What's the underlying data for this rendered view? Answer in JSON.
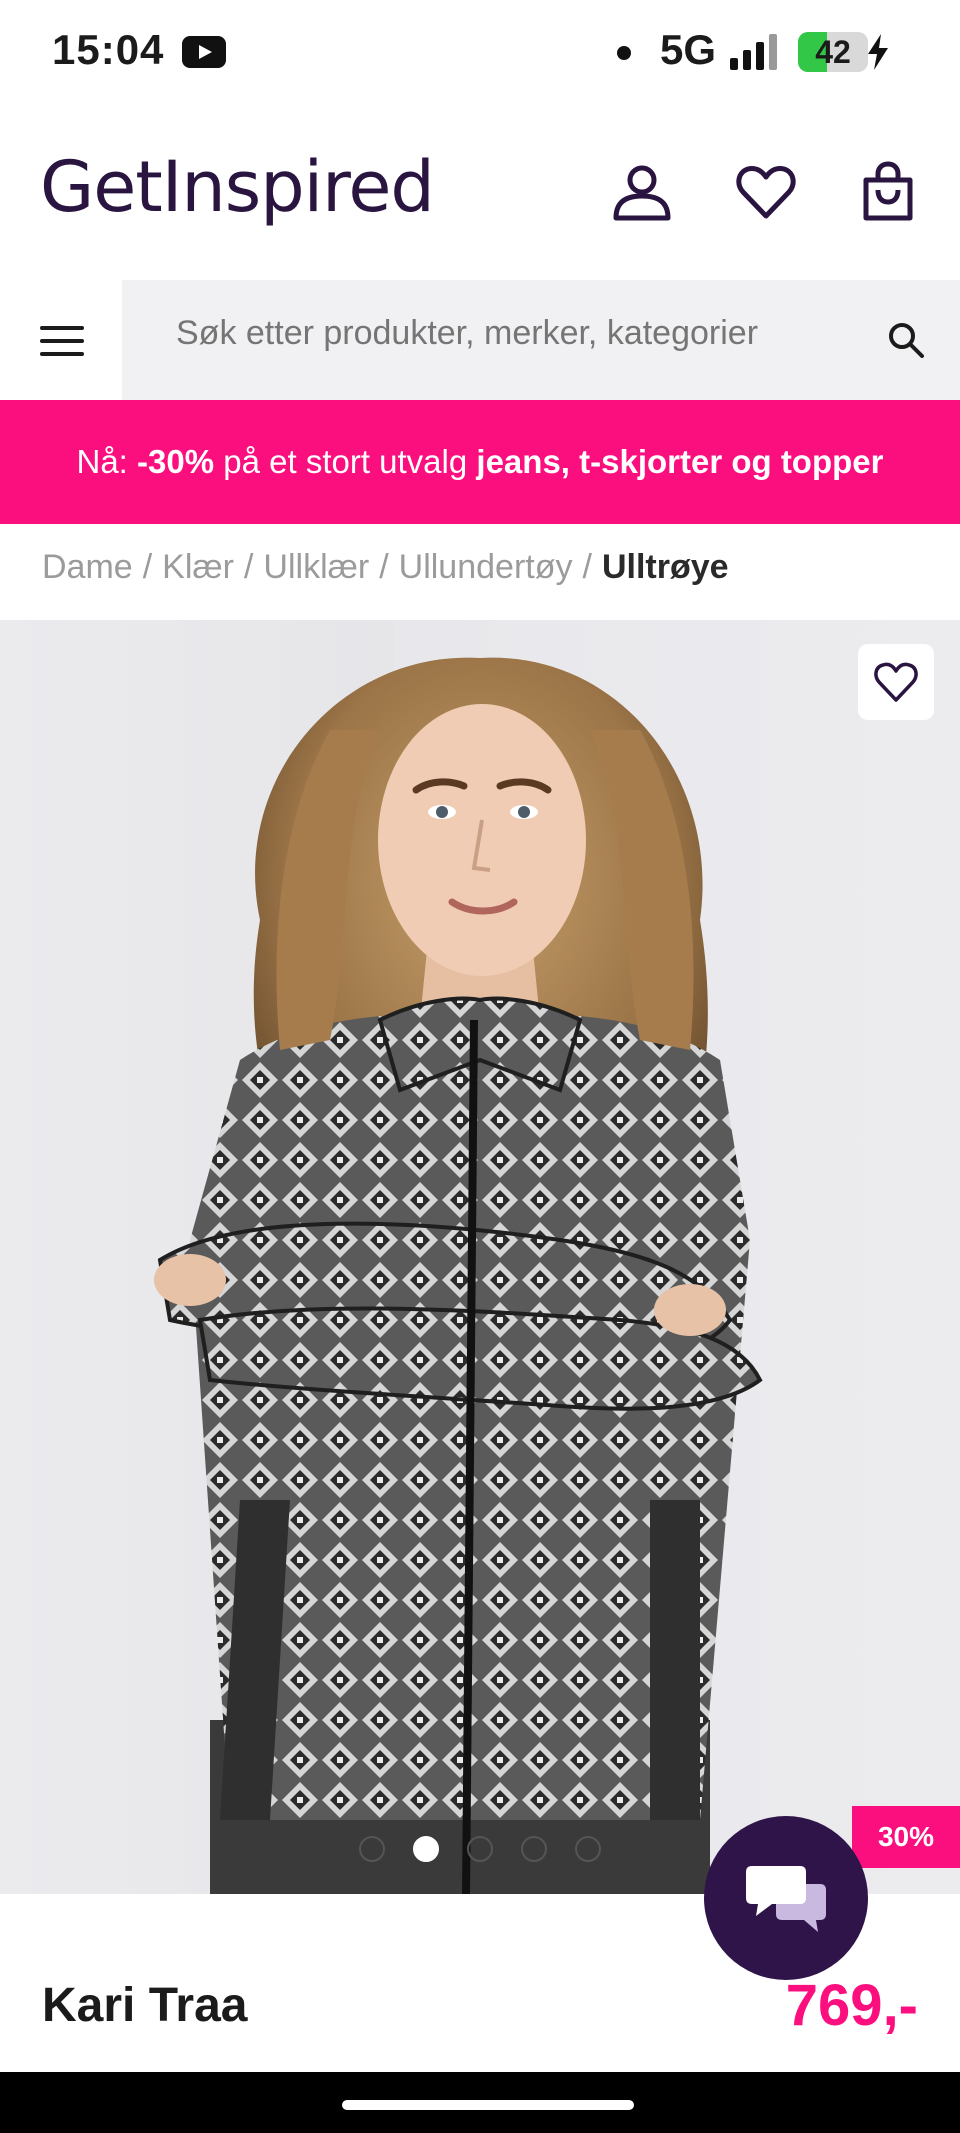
{
  "status_bar": {
    "time": "15:04",
    "network": "5G",
    "battery": "42",
    "battery_level": 0.42,
    "icons": [
      "youtube-icon",
      "notification-dot-icon",
      "signal-icon",
      "battery-icon",
      "charging-bolt-icon"
    ]
  },
  "header": {
    "logo": "GetInspired",
    "brand_color": "#2a1541",
    "icons": [
      "account-icon",
      "wishlist-heart-icon",
      "shopping-bag-icon"
    ]
  },
  "search": {
    "placeholder": "Søk etter produkter, merker, kategorier",
    "icon": "search-icon"
  },
  "promo": {
    "prefix": "Nå:",
    "discount": "-30%",
    "middle": "på et stort utvalg",
    "categories": "jeans, t-skjorter og topper",
    "color": "#fb0f7f"
  },
  "breadcrumb": {
    "items": [
      "Dame",
      "Klær",
      "Ullklær",
      "Ullundertøy"
    ],
    "separator": "/",
    "current": "Ulltrøye"
  },
  "product": {
    "image_count": 5,
    "active_image": 1,
    "discount_badge": "30%",
    "brand": "Kari Traa",
    "price": "769,-"
  },
  "colors": {
    "accent": "#fb0f7f",
    "chat_button": "#2e1448"
  }
}
